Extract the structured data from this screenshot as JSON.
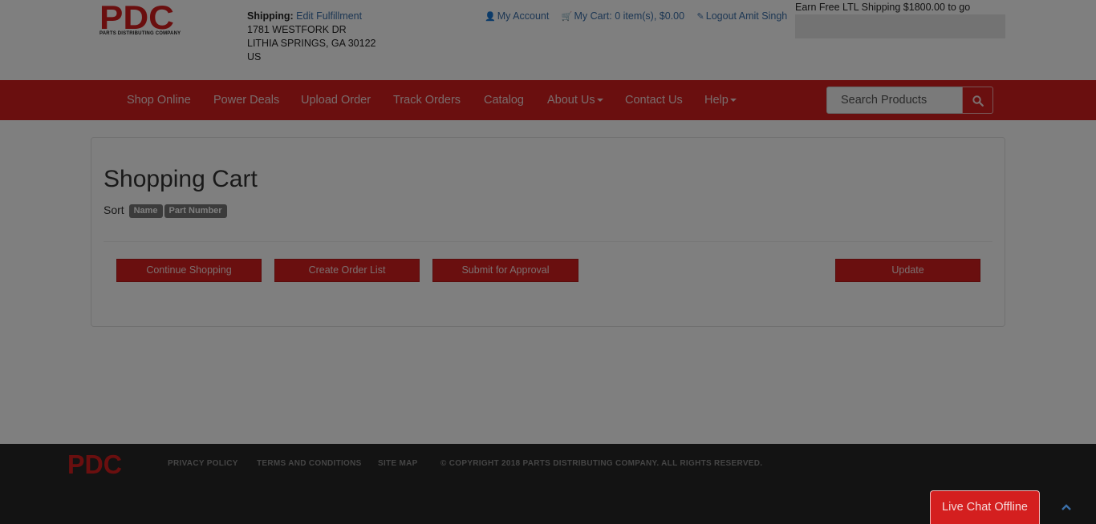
{
  "logo": {
    "letters": "PDC",
    "subtitle": "PARTS DISTRIBUTING COMPANY"
  },
  "shipping": {
    "label": "Shipping:",
    "edit_link": "Edit Fulfillment",
    "address_line1": "1781 WESTFORK DR",
    "address_line2": "LITHIA SPRINGS, GA 30122",
    "country": "US"
  },
  "account": {
    "my_account": "My Account",
    "my_cart": "My Cart: 0 item(s), $0.00",
    "logout": "Logout Amit Singh"
  },
  "ltl": {
    "text": "Earn Free LTL Shipping $1800.00 to go",
    "progress": 0
  },
  "nav": {
    "items": [
      {
        "label": "Shop Online"
      },
      {
        "label": "Power Deals"
      },
      {
        "label": "Upload Order"
      },
      {
        "label": "Track Orders"
      },
      {
        "label": "Catalog"
      },
      {
        "label": "About Us"
      },
      {
        "label": "Contact Us"
      },
      {
        "label": "Help"
      }
    ],
    "search_placeholder": "Search Products"
  },
  "cart": {
    "title": "Shopping Cart",
    "sort_label": "Sort",
    "sort_options": [
      "Name",
      "Part Number"
    ],
    "buttons": {
      "continue": "Continue Shopping",
      "create_list": "Create Order List",
      "submit": "Submit for Approval",
      "update": "Update"
    }
  },
  "footer": {
    "links": [
      "PRIVACY POLICY",
      "TERMS AND CONDITIONS",
      "SITE MAP"
    ],
    "copyright": "© COPYRIGHT 2018 PARTS DISTRIBUTING COMPANY. ALL RIGHTS RESERVED.",
    "chat": "Live Chat Offline"
  },
  "colors": {
    "brand_red": "#d41f1f",
    "link_blue": "#3b6fa8",
    "footer_bg": "#262626"
  }
}
